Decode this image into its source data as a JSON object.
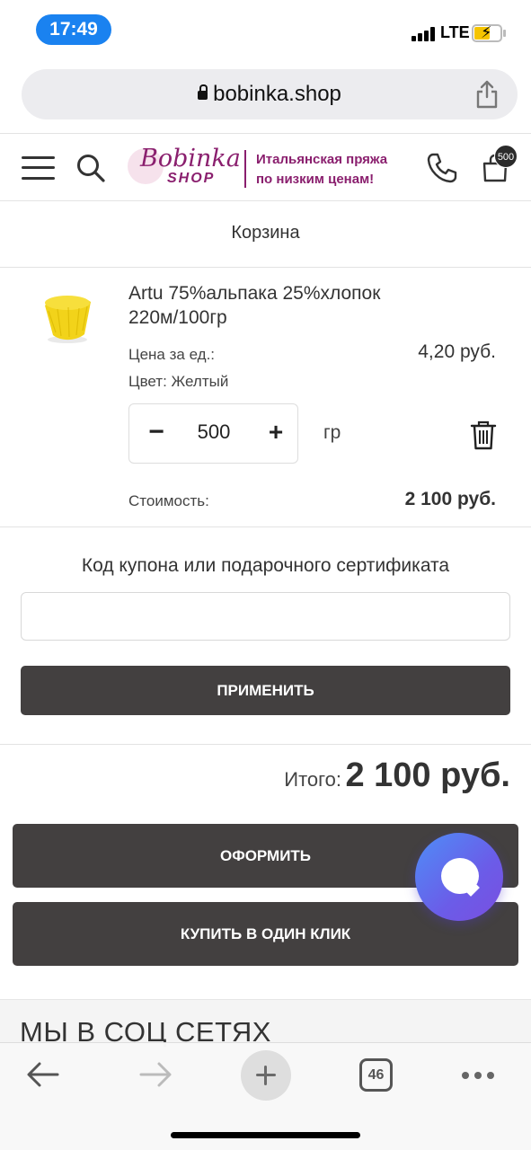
{
  "status_bar": {
    "time": "17:49",
    "network": "LTE"
  },
  "browser": {
    "url": "bobinka.shop",
    "open_tabs": "46"
  },
  "header": {
    "logo_line1": "Bobinka",
    "logo_line2": "SHOP",
    "tagline_line1": "Итальянская пряжа",
    "tagline_line2": "по низким ценам!",
    "cart_count": "500"
  },
  "page": {
    "title": "Корзина"
  },
  "cart_item": {
    "name": "Artu 75%альпака 25%хлопок 220м/100гр",
    "unit_price_label": "Цена за ед.:",
    "unit_price": "4,20 руб.",
    "color_label": "Цвет: Желтый",
    "quantity": "500",
    "unit": "гр",
    "cost_label": "Стоимость:",
    "cost": "2 100 руб."
  },
  "coupon": {
    "label": "Код купона или подарочного сертификата",
    "value": "",
    "apply_label": "ПРИМЕНИТЬ"
  },
  "total": {
    "label": "Итого:",
    "value": "2 100 руб."
  },
  "actions": {
    "checkout_label": "ОФОРМИТЬ",
    "one_click_label": "КУПИТЬ В ОДИН КЛИК"
  },
  "social": {
    "title": "МЫ В СОЦ СЕТЯХ"
  },
  "colors": {
    "brand": "#8a1f6e",
    "button": "#434040",
    "time_pill": "#1a82f0"
  }
}
